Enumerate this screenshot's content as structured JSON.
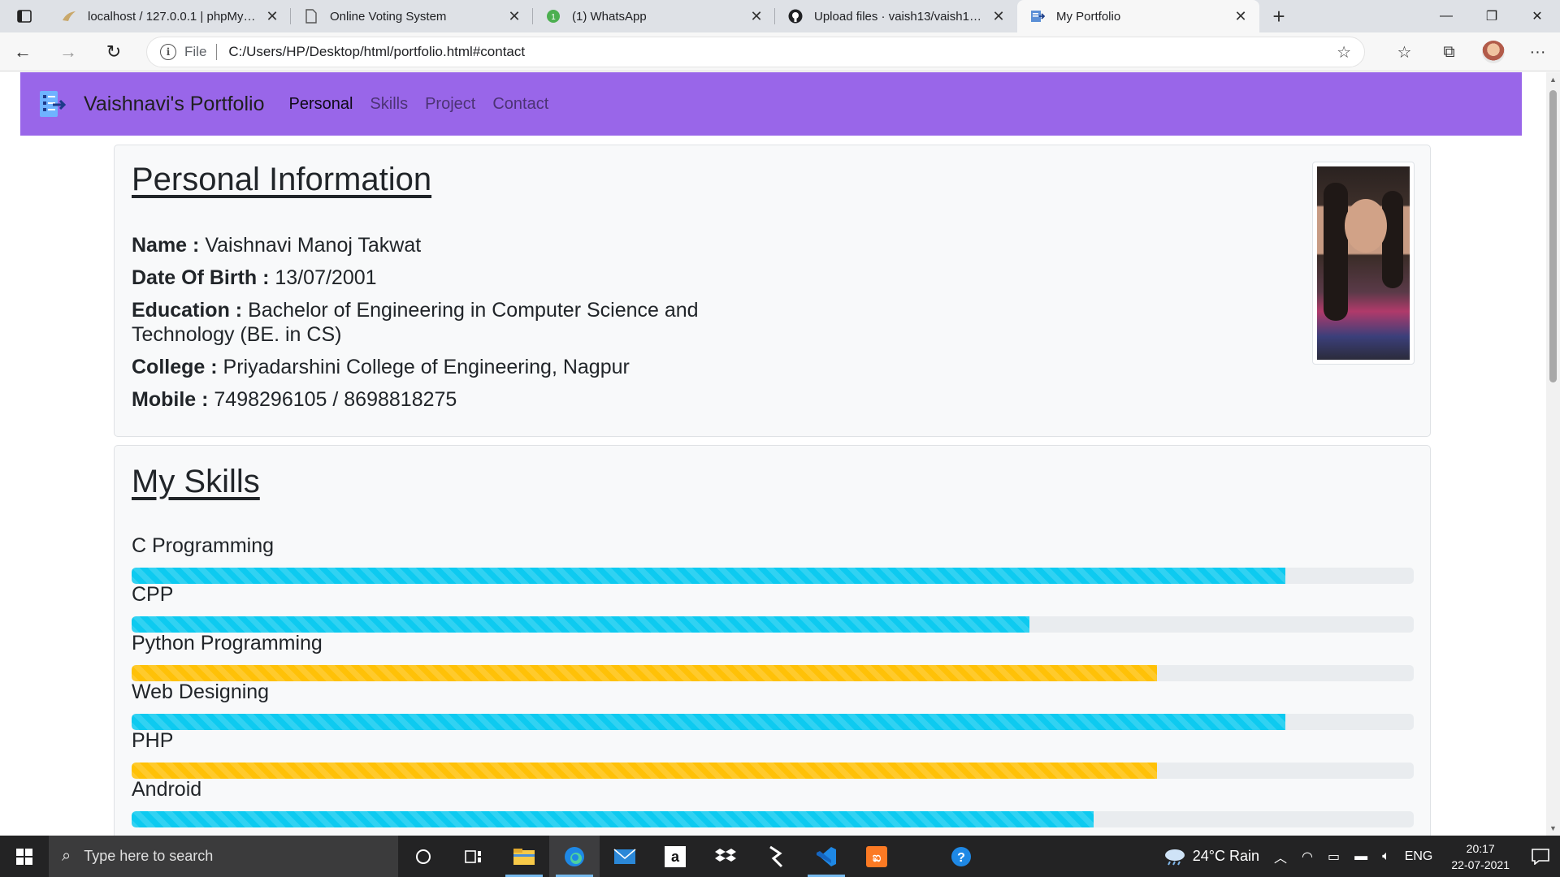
{
  "browser": {
    "tabs": [
      {
        "title": "localhost / 127.0.0.1 | phpMyAdmin",
        "favicon": "phpmyadmin-icon"
      },
      {
        "title": "Online Voting System",
        "favicon": "page-icon"
      },
      {
        "title": "(1) WhatsApp",
        "favicon": "whatsapp-icon"
      },
      {
        "title": "Upload files · vaish13/vaish13.github.io",
        "favicon": "github-icon"
      },
      {
        "title": "My Portfolio",
        "favicon": "portfolio-icon"
      }
    ],
    "active_tab_index": 4,
    "address": {
      "scheme_label": "File",
      "url": "C:/Users/HP/Desktop/html/portfolio.html#contact"
    }
  },
  "page": {
    "navbar": {
      "brand": "Vaishnavi's Portfolio",
      "links": [
        "Personal",
        "Skills",
        "Project",
        "Contact"
      ],
      "active_link": "Personal",
      "color": "#9966e9"
    },
    "personal": {
      "title": "Personal Information",
      "fields": [
        {
          "label": "Name :",
          "value": "Vaishnavi Manoj Takwat"
        },
        {
          "label": "Date Of Birth :",
          "value": "13/07/2001"
        },
        {
          "label": "Education :",
          "value": "Bachelor of Engineering in Computer Science and Technology (BE. in CS)"
        },
        {
          "label": "College :",
          "value": "Priyadarshini College of Engineering, Nagpur"
        },
        {
          "label": "Mobile :",
          "value": "7498296105 / 8698818275"
        }
      ]
    },
    "skills": {
      "title": "My Skills",
      "items": [
        {
          "name": "C Programming",
          "percent": 90,
          "color": "#0dcaf0"
        },
        {
          "name": "CPP",
          "percent": 70,
          "color": "#0dcaf0"
        },
        {
          "name": "Python Programming",
          "percent": 80,
          "color": "#ffc107"
        },
        {
          "name": "Web Designing",
          "percent": 90,
          "color": "#0dcaf0"
        },
        {
          "name": "PHP",
          "percent": 80,
          "color": "#ffc107"
        },
        {
          "name": "Android",
          "percent": 75,
          "color": "#0dcaf0"
        }
      ]
    }
  },
  "taskbar": {
    "search_placeholder": "Type here to search",
    "weather": "24°C  Rain",
    "language": "ENG",
    "time": "20:17",
    "date": "22-07-2021"
  }
}
